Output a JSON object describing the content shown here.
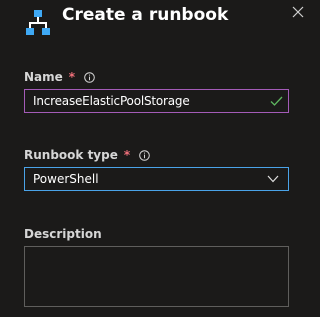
{
  "panel": {
    "title": "Create a runbook",
    "header_icon": "runbook-icon",
    "close_icon": "close-icon"
  },
  "fields": {
    "name": {
      "label": "Name",
      "required_mark": "*",
      "value": "IncreaseElasticPoolStorage",
      "valid": true
    },
    "runbook_type": {
      "label": "Runbook type",
      "required_mark": "*",
      "selected": "PowerShell"
    },
    "description": {
      "label": "Description",
      "value": ""
    }
  },
  "colors": {
    "background": "#1b1a19",
    "required": "#f1707b",
    "name_border": "#a45bb8",
    "select_border": "#4aa3e8",
    "valid_check": "#5fb760",
    "header_icon": "#3fa9f5"
  }
}
